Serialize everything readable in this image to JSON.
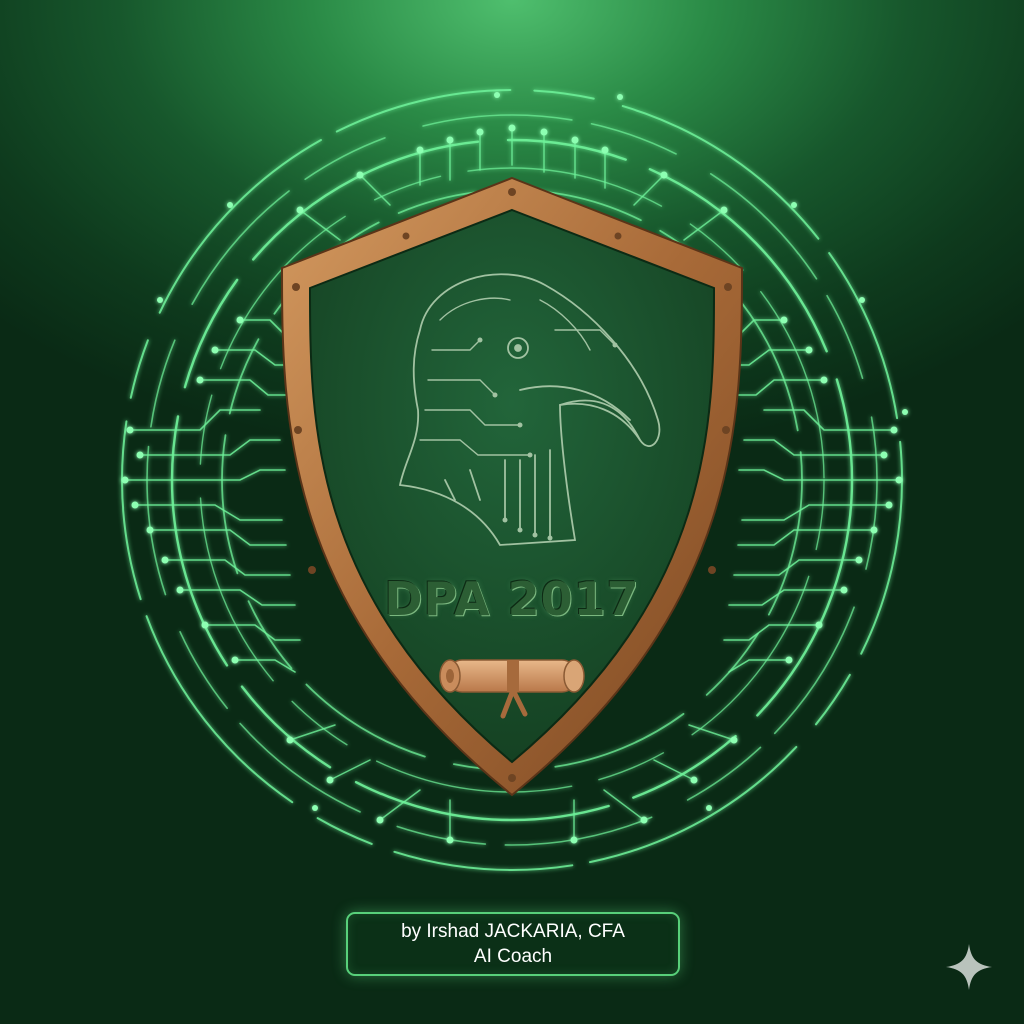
{
  "badge": {
    "title": "DPA 2017",
    "emblem": "dodo-bird-circuit-icon",
    "scroll": "scroll-icon"
  },
  "credit": {
    "line1": "by Irshad JACKARIA, CFA",
    "line2": "AI Coach"
  },
  "watermark": "sparkle-icon",
  "colors": {
    "background": "#0e3a1d",
    "circuit_glow": "#6ff29a",
    "shield_frame": "#b57a45",
    "shield_face": "#1d5a2c",
    "title_text": "#2c5e34",
    "credit_border": "#58d07a",
    "credit_text": "#ffffff"
  }
}
